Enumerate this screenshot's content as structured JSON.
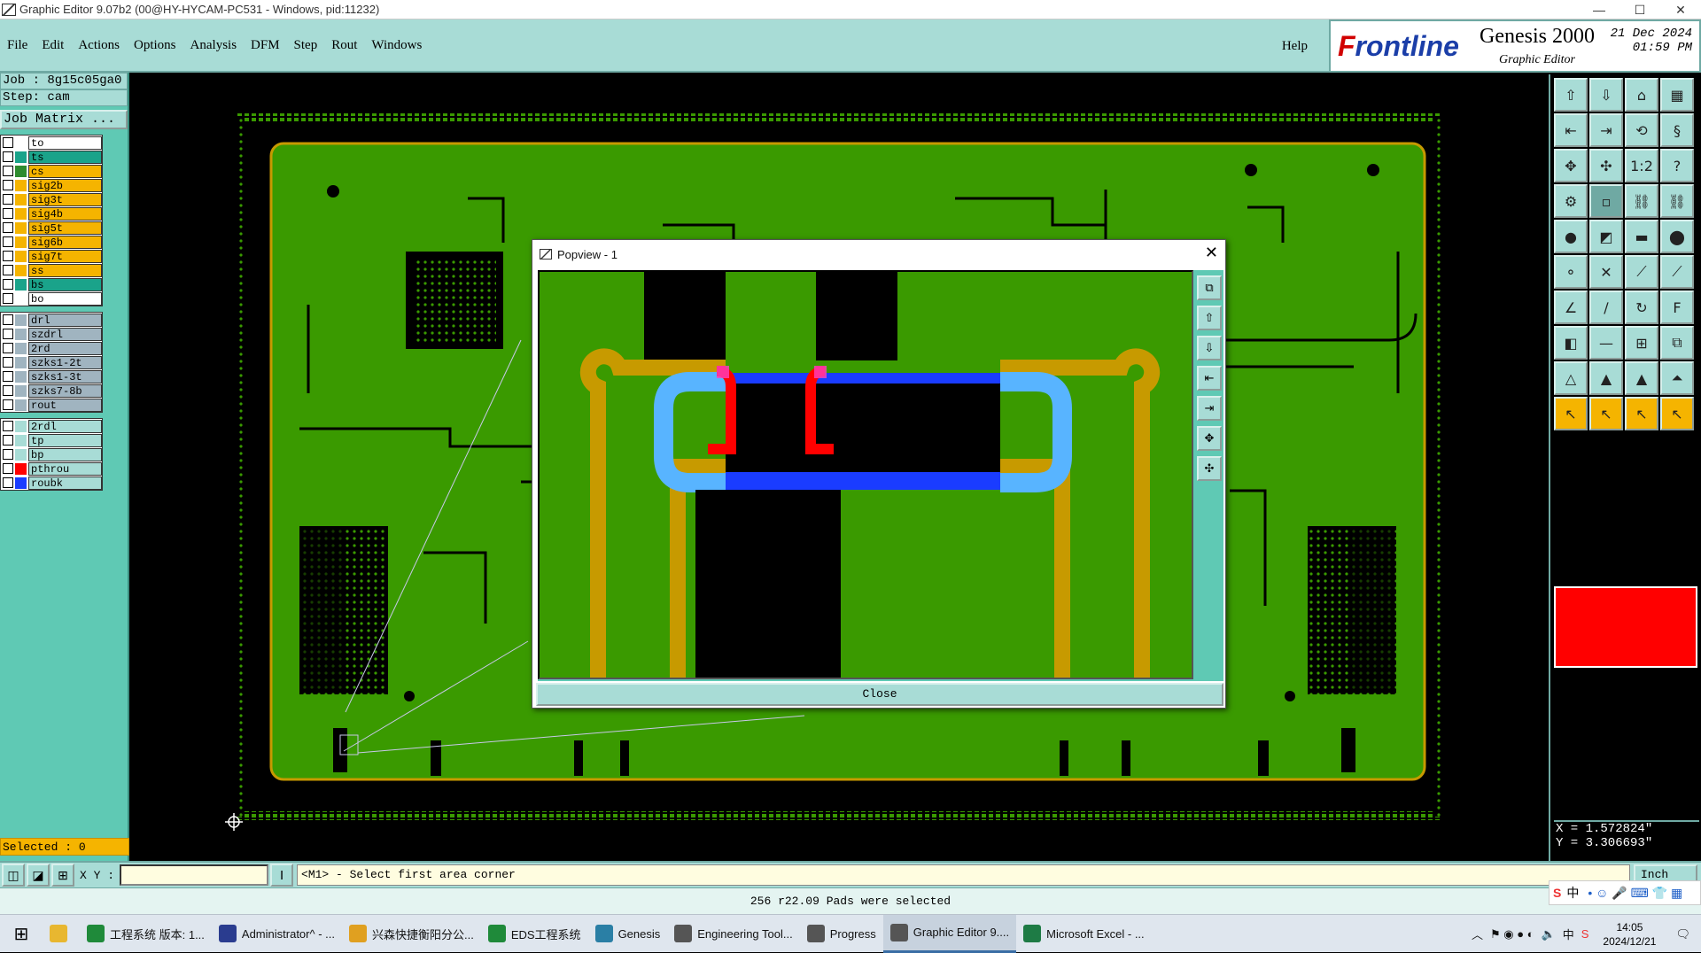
{
  "window": {
    "title": "Graphic Editor 9.07b2 (00@HY-HYCAM-PC531 - Windows, pid:11232)",
    "minimize": "—",
    "maximize": "☐",
    "close": "✕"
  },
  "menu": {
    "items": [
      "File",
      "Edit",
      "Actions",
      "Options",
      "Analysis",
      "DFM",
      "Step",
      "Rout",
      "Windows"
    ],
    "help": "Help"
  },
  "brand": {
    "logo_prefix": "F",
    "logo_rest": "rontline",
    "product": "Genesis 2000",
    "subtitle": "Graphic Editor",
    "date": "21 Dec 2024",
    "time": "01:59 PM"
  },
  "info": {
    "job": "Job : 8g15c05ga0",
    "step": "Step: cam",
    "job_matrix": "Job Matrix ..."
  },
  "layers": {
    "groups": [
      [
        {
          "name": "to",
          "color": "#ffffff",
          "fill": "#ffffff"
        },
        {
          "name": "ts",
          "color": "#1aa38a",
          "fill": "#1aa38a"
        },
        {
          "name": "cs",
          "color": "#2e8b2e",
          "fill": "#f5b400"
        },
        {
          "name": "sig2b",
          "color": "#f5b400",
          "fill": "#f5b400"
        },
        {
          "name": "sig3t",
          "color": "#f5b400",
          "fill": "#f5b400"
        },
        {
          "name": "sig4b",
          "color": "#f5b400",
          "fill": "#f5b400"
        },
        {
          "name": "sig5t",
          "color": "#f5b400",
          "fill": "#f5b400"
        },
        {
          "name": "sig6b",
          "color": "#f5b400",
          "fill": "#f5b400"
        },
        {
          "name": "sig7t",
          "color": "#f5b400",
          "fill": "#f5b400"
        },
        {
          "name": "ss",
          "color": "#f5b400",
          "fill": "#f5b400"
        },
        {
          "name": "bs",
          "color": "#1aa38a",
          "fill": "#1aa38a"
        },
        {
          "name": "bo",
          "color": "#ffffff",
          "fill": "#ffffff"
        }
      ],
      [
        {
          "name": "drl",
          "color": "#a0b4c0",
          "fill": "#a0b4c0"
        },
        {
          "name": "szdrl",
          "color": "#a0b4c0",
          "fill": "#a0b4c0"
        },
        {
          "name": "2rd",
          "color": "#a0b4c0",
          "fill": "#a0b4c0"
        },
        {
          "name": "szks1-2t",
          "color": "#a0b4c0",
          "fill": "#a0b4c0"
        },
        {
          "name": "szks1-3t",
          "color": "#a0b4c0",
          "fill": "#a0b4c0"
        },
        {
          "name": "szks7-8b",
          "color": "#a0b4c0",
          "fill": "#a0b4c0"
        },
        {
          "name": "rout",
          "color": "#a0b4c0",
          "fill": "#a0b4c0"
        }
      ],
      [
        {
          "name": "2rdl",
          "color": "#a8dcd6",
          "fill": "#a8dcd6"
        },
        {
          "name": "tp",
          "color": "#a8dcd6",
          "fill": "#a8dcd6"
        },
        {
          "name": "bp",
          "color": "#a8dcd6",
          "fill": "#a8dcd6"
        },
        {
          "name": "pthrou",
          "color": "#ff0000",
          "fill": "#a8dcd6"
        },
        {
          "name": "roubk",
          "color": "#1a3cff",
          "fill": "#a8dcd6"
        }
      ]
    ]
  },
  "selected": "Selected : 0",
  "coords": {
    "x": "X = 1.572824\"",
    "y": "Y = 3.306693\""
  },
  "command": {
    "xy_label": "X Y :",
    "xy_value": "",
    "prompt": "<M1> - Select first area corner",
    "units": "Inch"
  },
  "status": "256 r22.09 Pads were selected",
  "popview": {
    "title": "Popview - 1",
    "close_label": "Close"
  },
  "taskbar": {
    "items": [
      {
        "label": "工程系统   版本: 1...",
        "color": "#1f8a3a"
      },
      {
        "label": "Administrator^ - ...",
        "color": "#2a3c8f"
      },
      {
        "label": "兴森快捷衡阳分公...",
        "color": "#e0a020"
      },
      {
        "label": "EDS工程系统",
        "color": "#1f8a3a"
      },
      {
        "label": "Genesis",
        "color": "#2a7fa5"
      },
      {
        "label": "Engineering Tool...",
        "color": "#555555"
      },
      {
        "label": "Progress",
        "color": "#555555"
      },
      {
        "label": "Graphic Editor 9....",
        "color": "#555555"
      },
      {
        "label": "Microsoft Excel - ...",
        "color": "#1e7b45"
      }
    ],
    "active_index": 7,
    "tray_lang": "中",
    "clock_time": "14:05",
    "clock_date": "2024/12/21"
  },
  "ime": {
    "label": "中"
  },
  "colors": {
    "board_green": "#3a9a00",
    "board_border": "#c79a00",
    "panel_teal": "#5fc9b4",
    "menu_teal": "#a8dcd6",
    "highlight_red": "#ff0000"
  }
}
